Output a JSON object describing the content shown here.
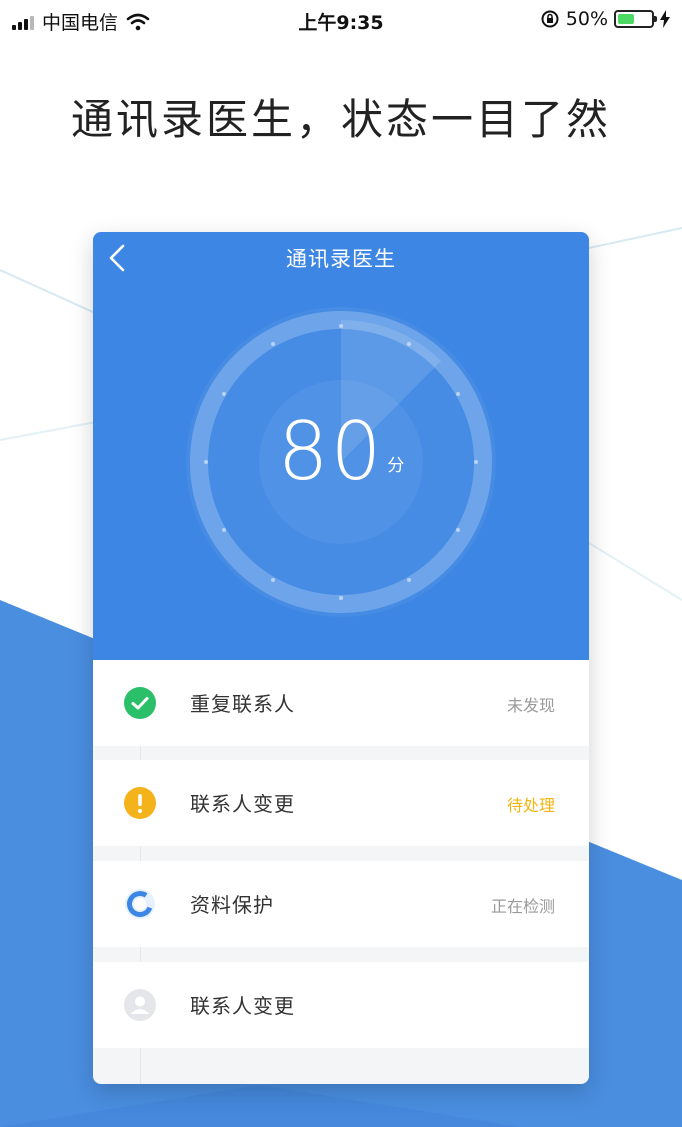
{
  "statusbar": {
    "carrier": "中国电信",
    "time": "上午9:35",
    "battery": "50%",
    "battery_level": 0.5
  },
  "headline": "通讯录医生，状态一目了然",
  "app": {
    "title": "通讯录医生",
    "score": "80",
    "score_unit": "分",
    "items": [
      {
        "label": "重复联系人",
        "status": "未发现",
        "icon": "check-circle-icon"
      },
      {
        "label": "联系人变更",
        "status": "待处理",
        "icon": "warning-circle-icon"
      },
      {
        "label": "资料保护",
        "status": "正在检测",
        "icon": "scanning-ring-icon"
      },
      {
        "label": "联系人变更",
        "status": "",
        "icon": "user-avatar-icon"
      }
    ]
  },
  "colors": {
    "primary": "#3d86e3",
    "success": "#2bbf6a",
    "warning": "#f5b31b",
    "background_accent": "#4a8ee0"
  }
}
